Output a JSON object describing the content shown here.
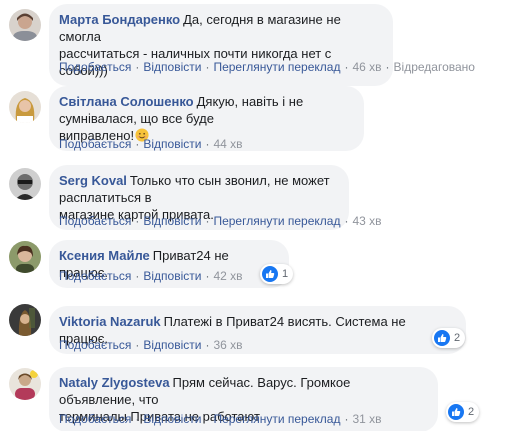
{
  "actions": {
    "like": "Подобається",
    "reply": "Відповісти",
    "translate": "Переглянути переклад",
    "edited": "Відредаговано"
  },
  "comments": [
    {
      "author": "Марта Бондаренко",
      "line1": "Да, сегодня в магазине не смогла",
      "line2": "рассчитаться - наличных почти никогда нет с собой)))",
      "time": "46 хв"
    },
    {
      "author": "Світлана Солошенко",
      "line1": "Дякую, навіть і не сумнівалася, що все буде",
      "line2": "виправлено!",
      "emoji": "smile-emoji",
      "time": "44 хв"
    },
    {
      "author": "Serg Koval",
      "line1": "Только что сын звонил, не может расплатиться в",
      "line2": "магазине картой привата.",
      "time": "43 хв"
    },
    {
      "author": "Ксения Майле",
      "line1": "Приват24 не працює.",
      "time": "42 хв",
      "reactions": "1"
    },
    {
      "author": "Viktoria Nazaruk",
      "line1": "Платежі в Приват24 висять. Система не працює.",
      "time": "36 хв",
      "reactions": "2"
    },
    {
      "author": "Nataly Zlygosteva",
      "line1": "Прям сейчас. Варус. Громкое объявление, что",
      "line2": "терминалы Привата не работают",
      "time": "31 хв",
      "reactions": "2"
    }
  ],
  "colors": {
    "link": "#385898",
    "bubble": "#f2f3f5",
    "like": "#1877f2"
  }
}
